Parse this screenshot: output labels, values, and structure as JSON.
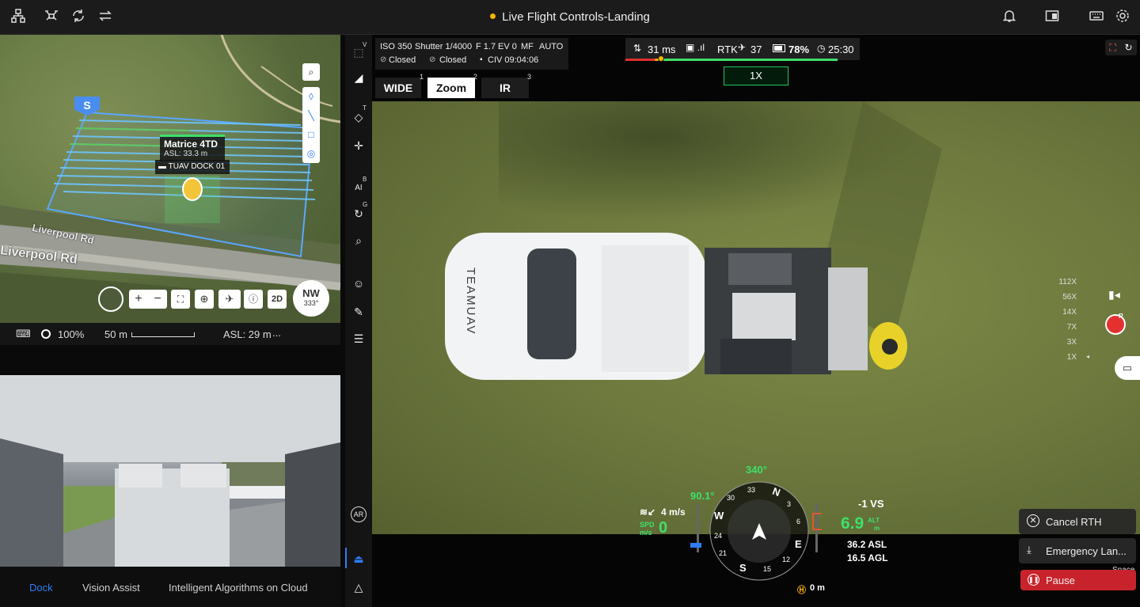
{
  "window": {
    "title": "Live Flight Controls-Landing",
    "status_color": "#f5b400"
  },
  "map": {
    "aircraft_name": "Matrice 4TD",
    "aircraft_asl": "ASL: 33.3 m",
    "dock_name": "TUAV DOCK 01",
    "road_label_1": "Liverpool Rd",
    "road_label_2": "Liverpool Rd",
    "start_marker": "S",
    "compass_dir": "NW",
    "compass_deg": "333°",
    "view_mode": "2D",
    "scale_pct": "100%",
    "scale_dist": "50 m",
    "map_asl": "ASL: 29 m",
    "more": "..."
  },
  "left_tabs": [
    {
      "label": "Dock"
    },
    {
      "label": "Vision Assist"
    },
    {
      "label": "Intelligent Algorithms on Cloud"
    }
  ],
  "toolbar": {
    "sup_v": "V",
    "sup_t": "T",
    "sup_b": "B",
    "sup_g": "G",
    "ai_label": "AI",
    "ar_label": "AR"
  },
  "camera_params": {
    "iso": "ISO 350",
    "shutter": "Shutter 1/4000",
    "aperture": "F 1.7",
    "ev": "EV 0",
    "focus": "MF",
    "wb": "AUTO",
    "closed_1": "Closed",
    "closed_2": "Closed",
    "civ": "CIV 09:04:06"
  },
  "lenses": [
    {
      "label": "WIDE",
      "key": "1"
    },
    {
      "label": "Zoom",
      "key": "2"
    },
    {
      "label": "IR",
      "key": "3"
    }
  ],
  "status": {
    "latency": "31 ms",
    "rtk_label": "RTK",
    "rtk_sats": "37",
    "battery": "78%",
    "time_left": "25:30",
    "zoom_level": "1X"
  },
  "zoom_scale": [
    "112X",
    "56X",
    "14X",
    "7X",
    "3X",
    "1X"
  ],
  "record_badge": "R",
  "hud": {
    "heading": "340°",
    "pitch": "90.1°",
    "wind": "4 m/s",
    "spd_label": "SPD",
    "spd_unit": "m/s",
    "speed": "0",
    "vs": "-1 VS",
    "alt": "6.9",
    "alt_label": "ALT",
    "alt_unit": "m",
    "asl": "36.2 ASL",
    "agl": "16.5 AGL",
    "home_dist": "0 m",
    "compass_marks": [
      "N",
      "3",
      "6",
      "E",
      "12",
      "15",
      "S",
      "21",
      "24",
      "W",
      "30",
      "33"
    ]
  },
  "actions": {
    "cancel_rth": "Cancel RTH",
    "emergency": "Emergency Lan...",
    "pause": "Pause",
    "pause_key": "Space"
  },
  "vehicle_text": "TEAMUAV",
  "colors": {
    "accent_blue": "#2f7df6",
    "pause_red": "#c8232c",
    "hud_green": "#3ee06a",
    "route_blue": "#5aa7ff"
  }
}
